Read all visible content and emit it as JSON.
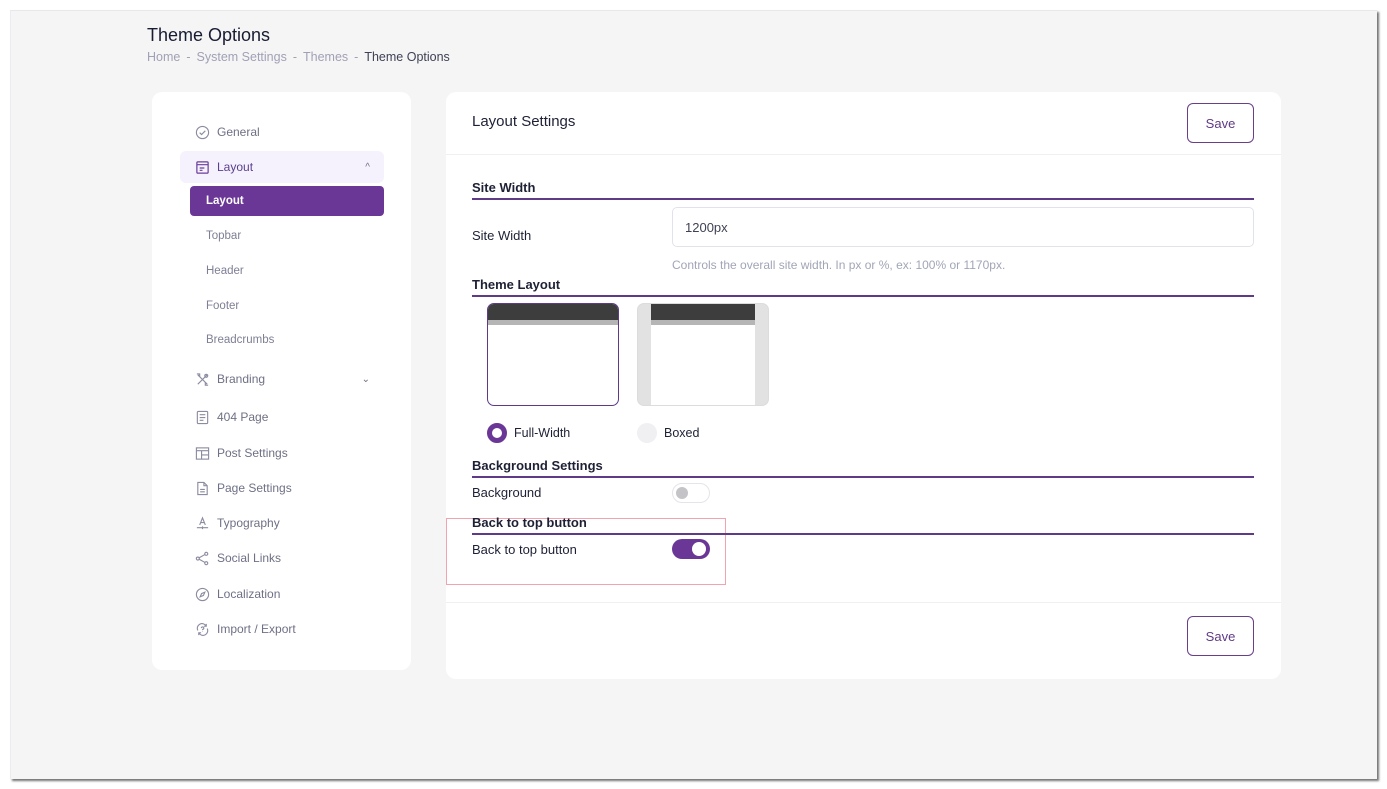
{
  "page": {
    "title": "Theme Options",
    "breadcrumb": [
      "Home",
      "System Settings",
      "Themes",
      "Theme Options"
    ],
    "breadcrumb_separator": "-"
  },
  "sidebar": {
    "items": [
      {
        "label": "General",
        "icon": "check-circle-icon"
      },
      {
        "label": "Layout",
        "icon": "layout-icon",
        "expanded": true,
        "chevron": "^"
      },
      {
        "label": "Branding",
        "icon": "tools-icon",
        "chevron": "⌄"
      },
      {
        "label": "404 Page",
        "icon": "document-list-icon"
      },
      {
        "label": "Post Settings",
        "icon": "post-layout-icon"
      },
      {
        "label": "Page Settings",
        "icon": "file-icon"
      },
      {
        "label": "Typography",
        "icon": "typography-icon"
      },
      {
        "label": "Social Links",
        "icon": "share-icon"
      },
      {
        "label": "Localization",
        "icon": "compass-icon"
      },
      {
        "label": "Import / Export",
        "icon": "import-export-icon"
      }
    ],
    "layout_subitems": [
      {
        "label": "Layout",
        "active": true
      },
      {
        "label": "Topbar"
      },
      {
        "label": "Header"
      },
      {
        "label": "Footer"
      },
      {
        "label": "Breadcrumbs"
      }
    ]
  },
  "panel": {
    "title": "Layout Settings",
    "save_label": "Save",
    "sections": {
      "site_width": {
        "title": "Site Width",
        "label": "Site Width",
        "value": "1200px",
        "hint": "Controls the overall site width. In px or %, ex: 100% or 1170px."
      },
      "theme_layout": {
        "title": "Theme Layout",
        "options": [
          {
            "label": "Full-Width",
            "selected": true
          },
          {
            "label": "Boxed",
            "selected": false
          }
        ]
      },
      "background": {
        "title": "Background Settings",
        "label": "Background",
        "enabled": false
      },
      "back_to_top": {
        "title": "Back to top button",
        "label": "Back to top button",
        "enabled": true
      }
    }
  },
  "colors": {
    "accent": "#6a3797",
    "background": "#f5f5f6",
    "highlight": "#f1a3b0"
  }
}
